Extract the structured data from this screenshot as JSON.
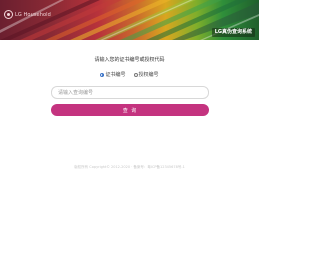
{
  "header": {
    "brand": "LG Household",
    "system_title": "LG真伪查询系统"
  },
  "main": {
    "prompt": "请输入您的证书编号或授权代码",
    "options": [
      {
        "label": "证书编号",
        "checked": true
      },
      {
        "label": "授权编号",
        "checked": false
      }
    ],
    "search": {
      "placeholder": "请输入查询编号",
      "value": ""
    },
    "query_label": "查 询"
  },
  "footer": {
    "text": "版权所有 Copyright© 2012-2020 · 备案号：粤ICP备12345678号-1"
  },
  "colors": {
    "accent": "#c4337f",
    "radio_selected": "#3b74c8"
  }
}
